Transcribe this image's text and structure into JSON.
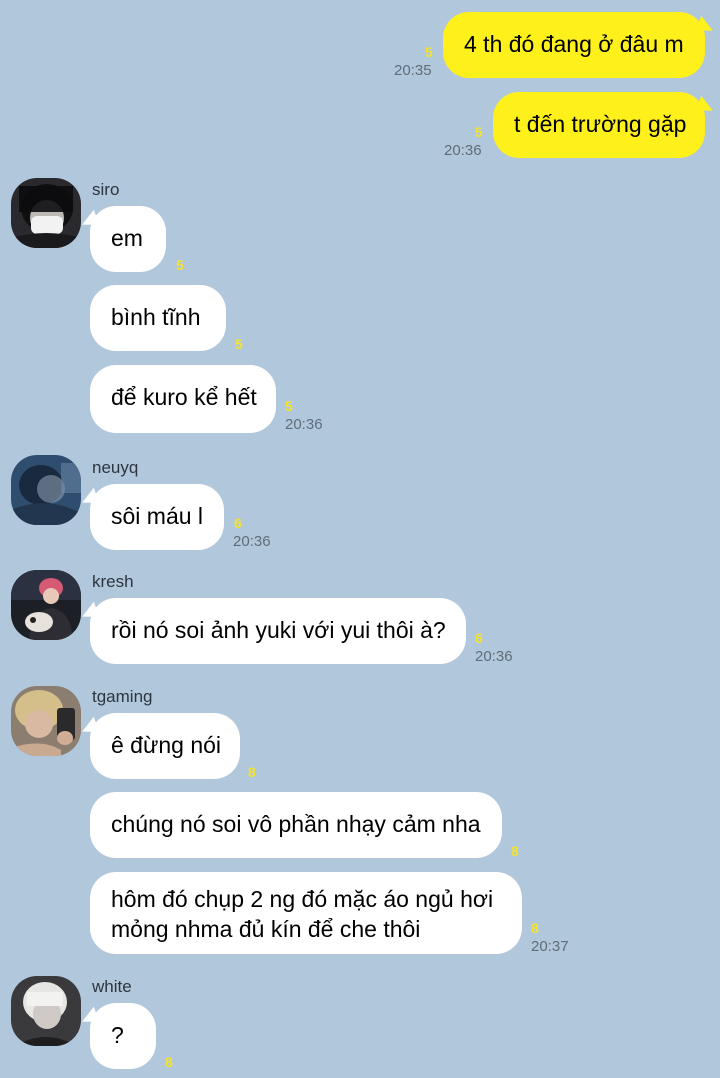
{
  "colors": {
    "background": "#b1c7dc",
    "my_bubble": "#fef01b",
    "other_bubble": "#ffffff",
    "unread": "#f5e32a",
    "time": "#5f6d7a"
  },
  "messages": {
    "m1": {
      "text": "4 th đó đang ở đâu m",
      "unread": "5",
      "time": "20:35"
    },
    "m2": {
      "text": "t đến trường gặp",
      "unread": "5",
      "time": "20:36"
    },
    "siro": {
      "name": "siro",
      "avatar_icon": "masked-person-avatar",
      "b1": {
        "text": "em",
        "unread": "5"
      },
      "b2": {
        "text": "bình tĩnh",
        "unread": "5"
      },
      "b3": {
        "text": "để kuro kể hết",
        "unread": "5",
        "time": "20:36"
      }
    },
    "neuyq": {
      "name": "neuyq",
      "avatar_icon": "dark-blue-person-avatar",
      "b1": {
        "text": "sôi máu l",
        "unread": "6",
        "time": "20:36"
      }
    },
    "kresh": {
      "name": "kresh",
      "avatar_icon": "pink-hair-person-with-dog-avatar",
      "b1": {
        "text": "rồi nó soi ảnh yuki với yui thôi à?",
        "unread": "6",
        "time": "20:36"
      }
    },
    "tgaming": {
      "name": "tgaming",
      "avatar_icon": "blonde-person-mirror-selfie-avatar",
      "b1": {
        "text": "ê đừng nói",
        "unread": "8"
      },
      "b2": {
        "text": "chúng nó soi vô phần nhạy cảm nha",
        "unread": "8"
      },
      "b3": {
        "text": "hôm đó chụp 2 ng đó mặc áo ngủ hơi mỏng nhma đủ kín để che thôi",
        "unread": "8",
        "time": "20:37"
      }
    },
    "white": {
      "name": "white",
      "avatar_icon": "white-hair-person-avatar",
      "b1": {
        "text": "?",
        "unread": "8"
      }
    }
  }
}
